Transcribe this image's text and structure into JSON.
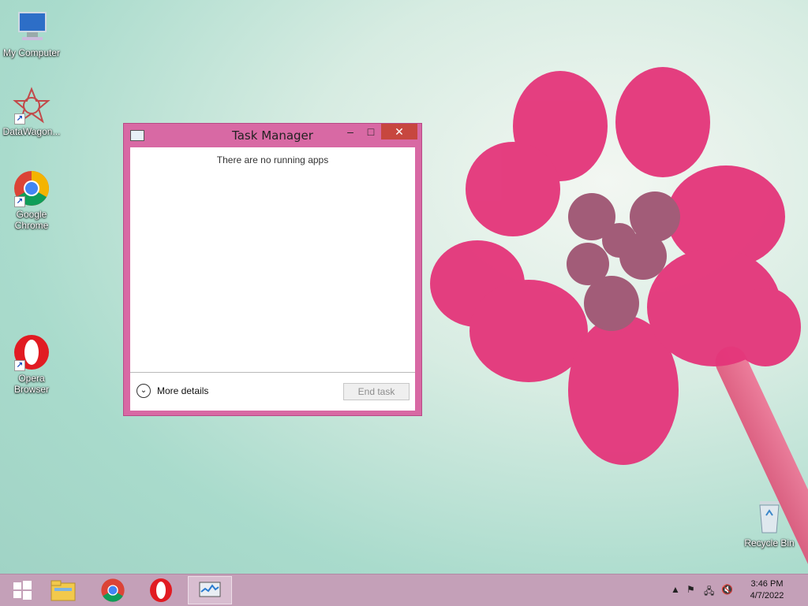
{
  "desktop": {
    "icons": [
      {
        "label": "My Computer"
      },
      {
        "label": "DataWagon..."
      },
      {
        "label": "Google Chrome"
      },
      {
        "label": "Opera Browser"
      },
      {
        "label": "Recycle Bin"
      }
    ]
  },
  "window": {
    "title": "Task Manager",
    "empty_message": "There are no running apps",
    "more_details": "More details",
    "end_task": "End task"
  },
  "taskbar": {
    "time": "3:46 PM",
    "date": "4/7/2022"
  },
  "colors": {
    "window_frame": "#d869a4",
    "close_button": "#c7473f",
    "taskbar": "#c4a0b8"
  }
}
